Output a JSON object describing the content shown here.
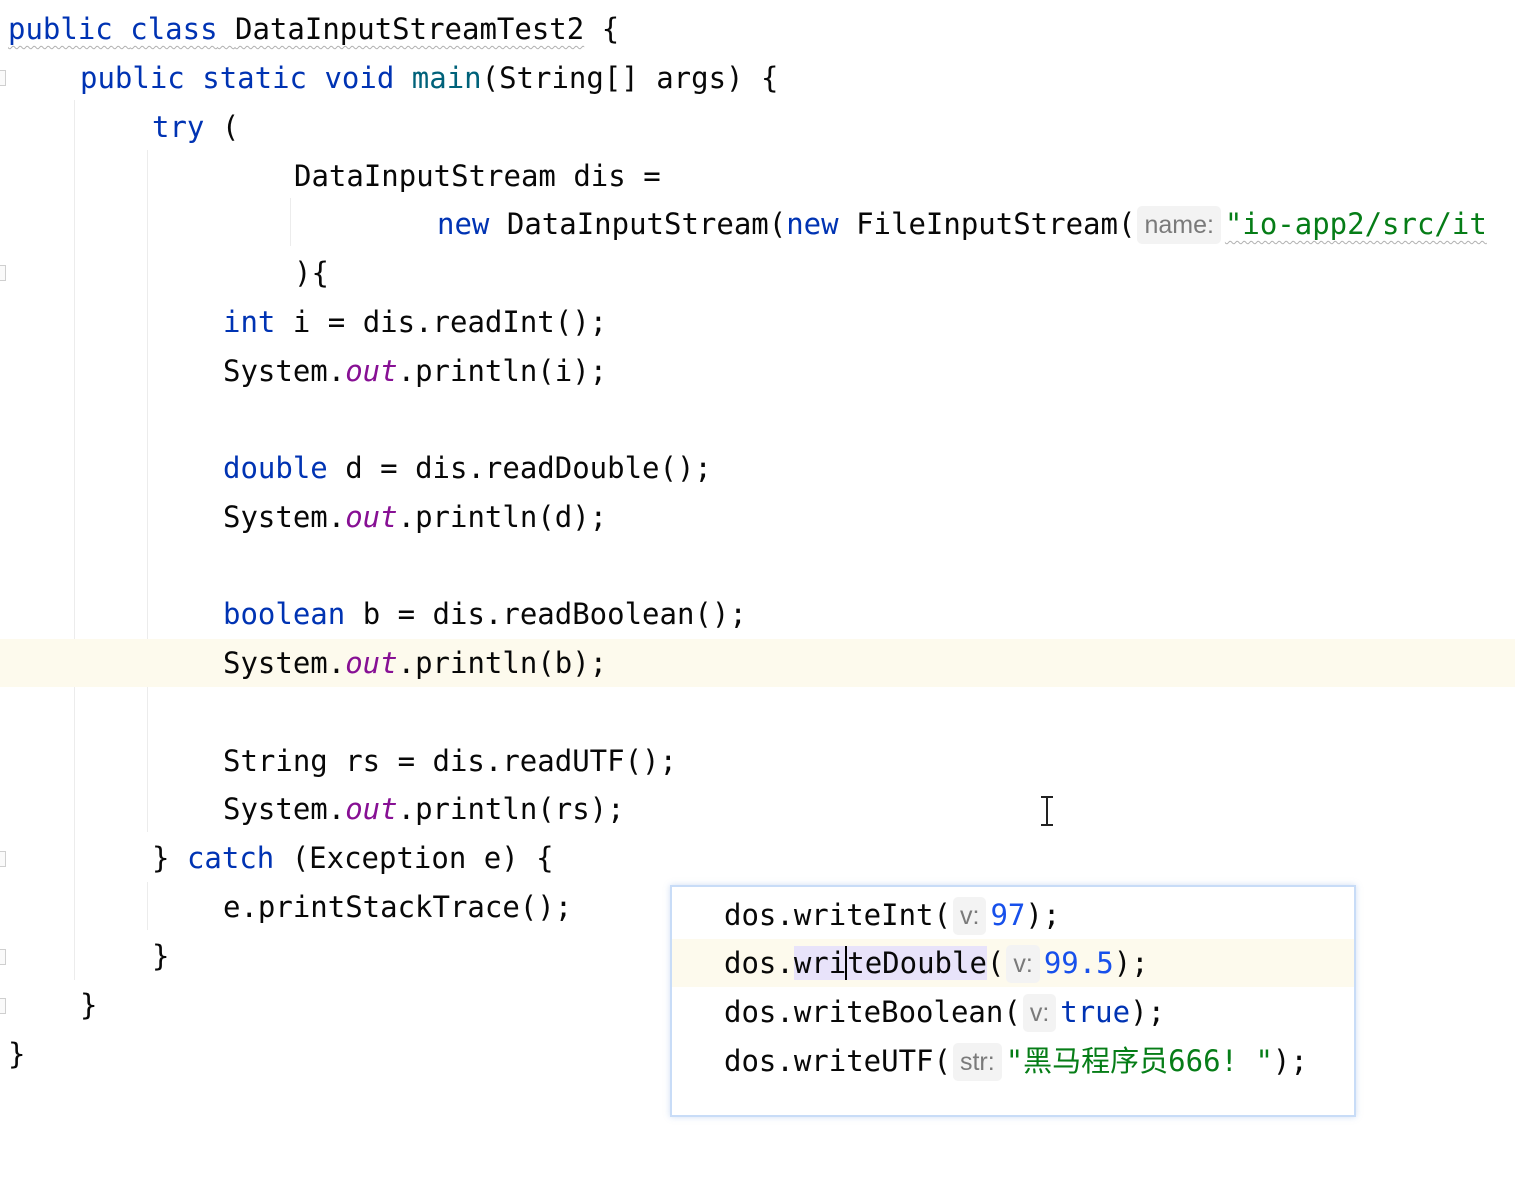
{
  "editor": {
    "lines": [
      {
        "kw1": "public",
        "kw2": "class",
        "name": "DataInputStreamTest2",
        "brace": "{"
      },
      {
        "kw1": "public",
        "kw2": "static",
        "kw3": "void",
        "method": "main",
        "params": "(String[] args) {"
      },
      {
        "kw": "try",
        "rest": "("
      },
      {
        "text": "DataInputStream dis ="
      },
      {
        "kw1": "new",
        "mid": "DataInputStream(",
        "kw2": "new",
        "ctor": "FileInputStream(",
        "hint": "name:",
        "str": "\"io-app2/src/it"
      },
      {
        "text": "){"
      },
      {
        "kw": "int",
        "rest": "i = dis.readInt();"
      },
      {
        "pre": "System.",
        "field": "out",
        "post": ".println(i);"
      },
      {
        "kw": "double",
        "rest": "d = dis.readDouble();"
      },
      {
        "pre": "System.",
        "field": "out",
        "post": ".println(d);"
      },
      {
        "kw": "boolean",
        "rest": "b = dis.readBoolean();"
      },
      {
        "pre": "System.",
        "field": "out",
        "post": ".println(b);"
      },
      {
        "text": "String rs = dis.readUTF();"
      },
      {
        "pre": "System.",
        "field": "out",
        "post": ".println(rs);"
      },
      {
        "brace": "}",
        "kw": "catch",
        "rest": "(Exception e) {"
      },
      {
        "text": "e.printStackTrace();"
      },
      {
        "text": "}"
      },
      {
        "text": "}"
      },
      {
        "text": "}"
      }
    ]
  },
  "popup": {
    "lines": [
      {
        "pre": "dos.writeInt(",
        "hint": "v:",
        "value": "97",
        "post": ");"
      },
      {
        "pre": "dos.",
        "sel_a": "wri",
        "sel_b": "teDouble",
        "paren": "(",
        "hint": "v:",
        "value": "99.5",
        "post": ");"
      },
      {
        "pre": "dos.writeBoolean(",
        "hint": "v:",
        "value": "true",
        "post": ");"
      },
      {
        "pre": "dos.writeUTF(",
        "hint": "str:",
        "value": "\"黑马程序员666! \"",
        "post": ");"
      }
    ]
  },
  "colors": {
    "keyword": "#0033b3",
    "static_field": "#871094",
    "string": "#067d17",
    "number": "#1750eb",
    "current_line": "#fdfaed",
    "selection": "#e8e3fa",
    "popup_border": "#c8dcf7"
  },
  "icons": {
    "cursor": "text-cursor-icon",
    "fold": "fold-marker-icon"
  }
}
